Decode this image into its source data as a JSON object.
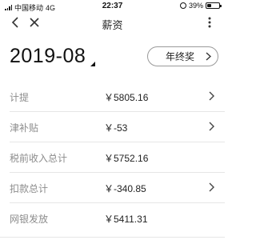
{
  "status_bar": {
    "carrier": "中国移动",
    "network": "4G",
    "time": "22:37",
    "battery": "39%",
    "battery_level": 0.39
  },
  "nav": {
    "title": "薪资"
  },
  "period": {
    "month": "2019-08"
  },
  "badge": {
    "label": "年终奖"
  },
  "rows": [
    {
      "label": "计提",
      "amount": "￥5805.16",
      "has_chevron": true
    },
    {
      "label": "津补贴",
      "amount": "￥-53",
      "has_chevron": true
    },
    {
      "label": "税前收入总计",
      "amount": "￥5752.16",
      "has_chevron": false
    },
    {
      "label": "扣款总计",
      "amount": "￥-340.85",
      "has_chevron": true
    },
    {
      "label": "网银发放",
      "amount": "￥5411.31",
      "has_chevron": false
    }
  ]
}
